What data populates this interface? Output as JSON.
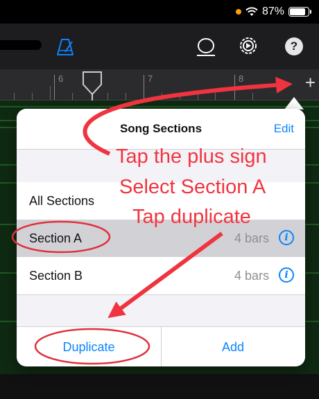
{
  "status": {
    "battery": "87%",
    "battery_level": 0.87
  },
  "ruler": {
    "marks": [
      "6",
      "7",
      "8"
    ]
  },
  "toolbar": {
    "icons": [
      "metronome-icon",
      "loop-icon",
      "settings-icon",
      "help-icon"
    ]
  },
  "popover": {
    "title": "Song Sections",
    "edit_label": "Edit",
    "rows": [
      {
        "label": "All Sections"
      },
      {
        "label": "Section A",
        "bars": "4 bars"
      },
      {
        "label": "Section B",
        "bars": "4 bars"
      }
    ],
    "duplicate_label": "Duplicate",
    "add_label": "Add"
  },
  "annotations": {
    "line1": "Tap the plus sign",
    "line2": "Select Section A",
    "line3": "Tap duplicate"
  },
  "colors": {
    "accent": "#0a84ff",
    "annotation": "#f0343f",
    "track_green": "#0f2a12"
  }
}
